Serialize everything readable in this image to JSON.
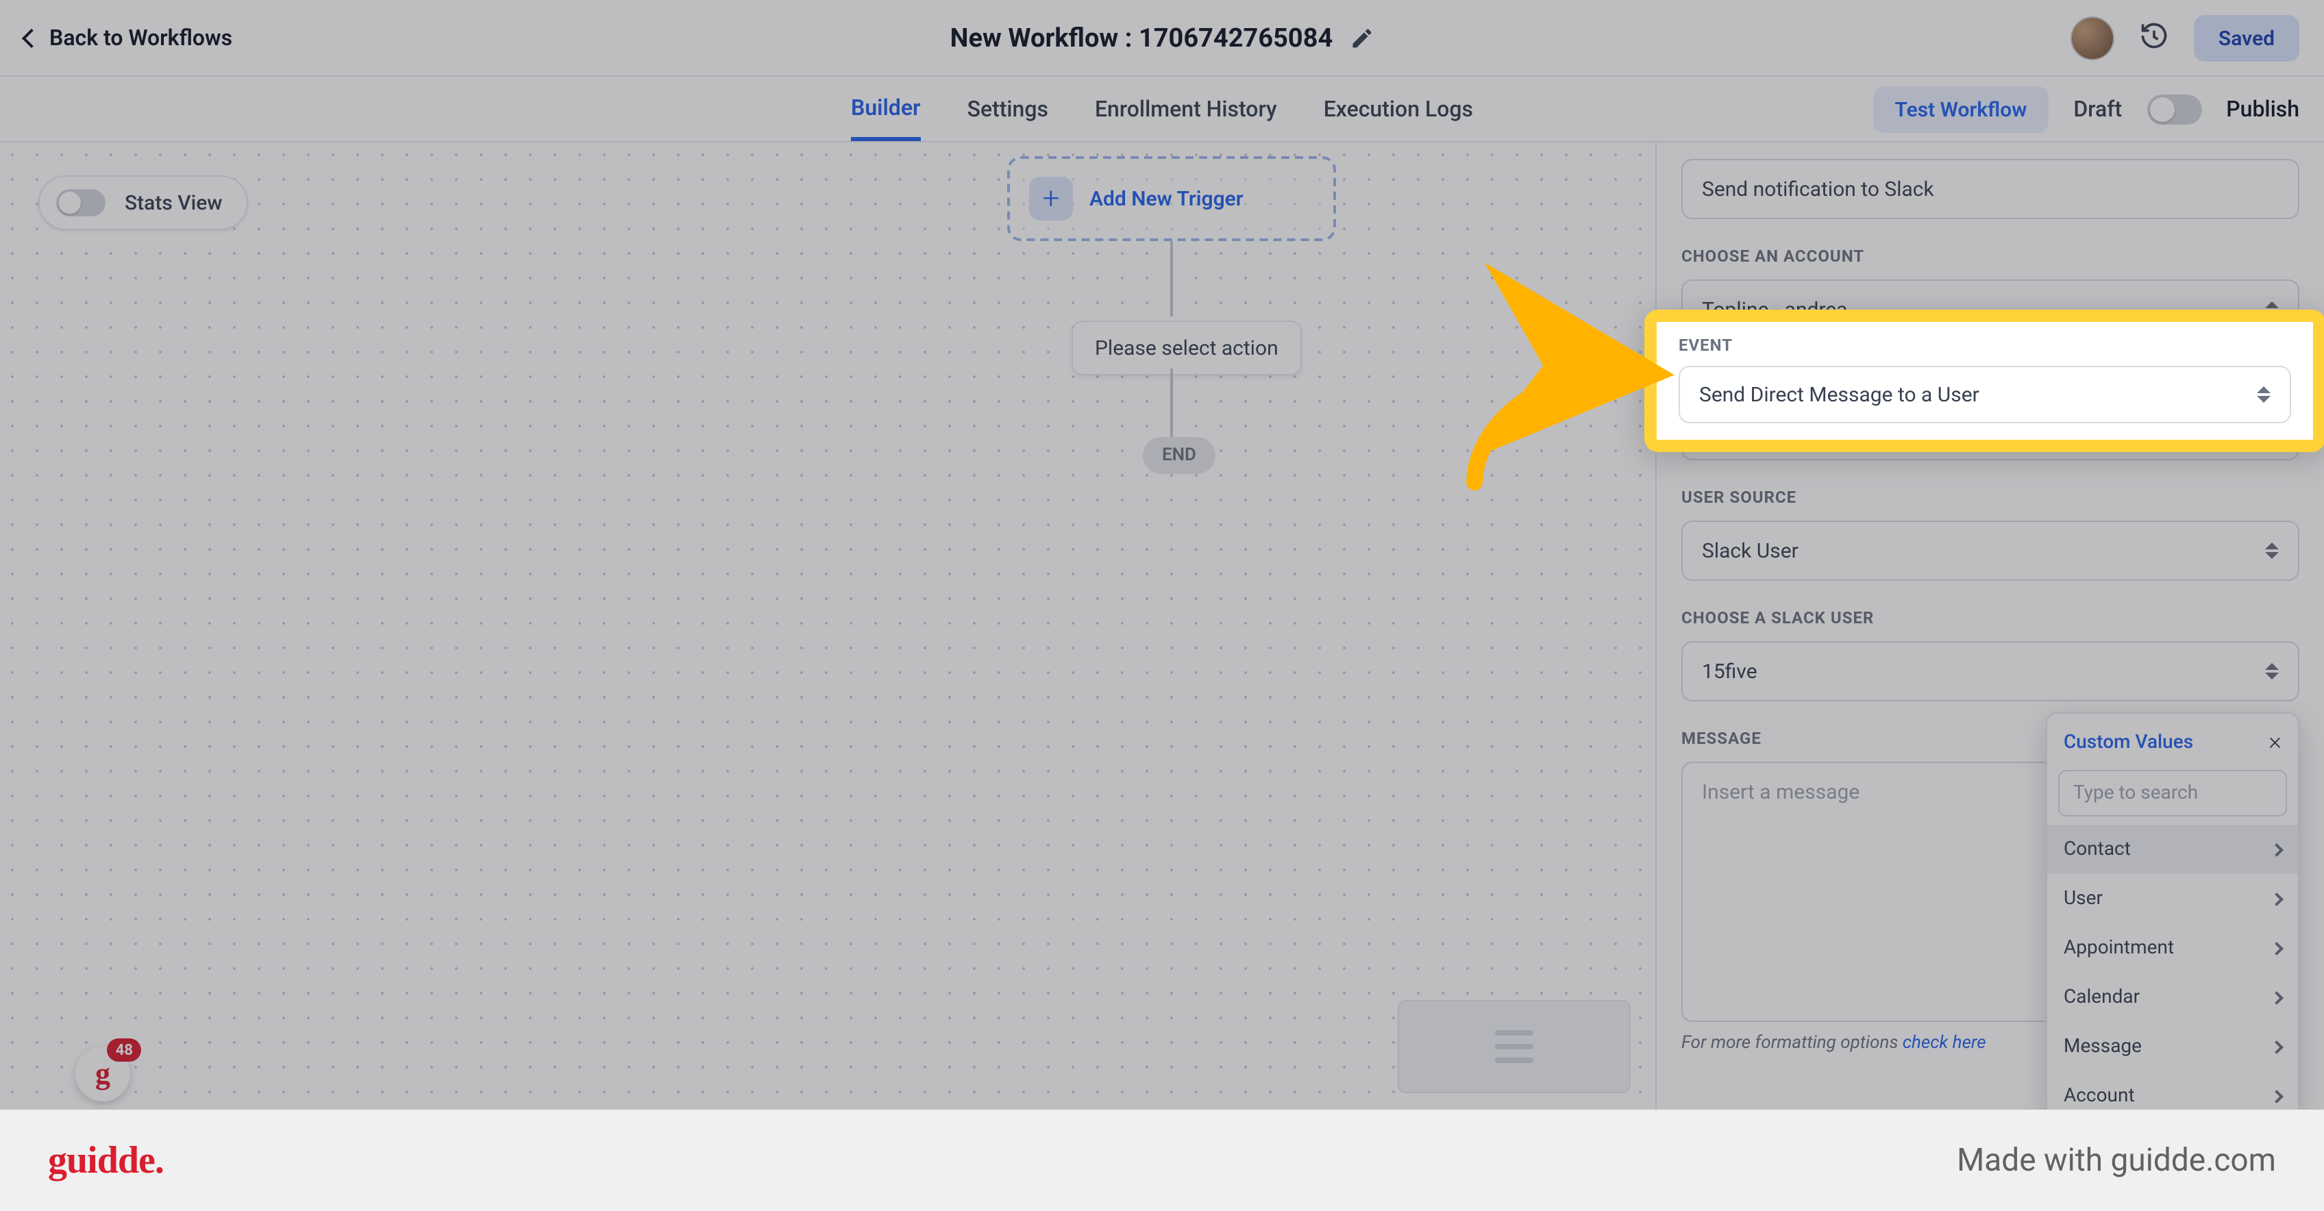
{
  "header": {
    "back_label": "Back to Workflows",
    "title": "New Workflow : 1706742765084",
    "saved_label": "Saved"
  },
  "tabs": {
    "builder": "Builder",
    "settings": "Settings",
    "enrollment": "Enrollment History",
    "execution": "Execution Logs",
    "test": "Test Workflow",
    "draft": "Draft",
    "publish": "Publish"
  },
  "canvas": {
    "stats_view": "Stats View",
    "add_trigger": "Add New Trigger",
    "select_action": "Please select action",
    "end": "END",
    "g_badge_count": "48"
  },
  "panel": {
    "action_name_value": "Send notification to Slack",
    "choose_account_label": "CHOOSE AN ACCOUNT",
    "account_value": "Topline - andrea",
    "event_label": "EVENT",
    "event_value": "Send Direct Message to a User",
    "user_source_label": "USER SOURCE",
    "user_source_value": "Slack User",
    "choose_slack_user_label": "CHOOSE A SLACK USER",
    "slack_user_value": "15five",
    "message_label": "MESSAGE",
    "message_placeholder": "Insert a message",
    "tip_prefix": "For more formatting options ",
    "tip_link": "check here"
  },
  "popover": {
    "title": "Custom Values",
    "search_placeholder": "Type to search",
    "items": [
      "Contact",
      "User",
      "Appointment",
      "Calendar",
      "Message",
      "Account"
    ]
  },
  "footer": {
    "logo": "guidde",
    "made_with": "Made with guidde.com"
  }
}
